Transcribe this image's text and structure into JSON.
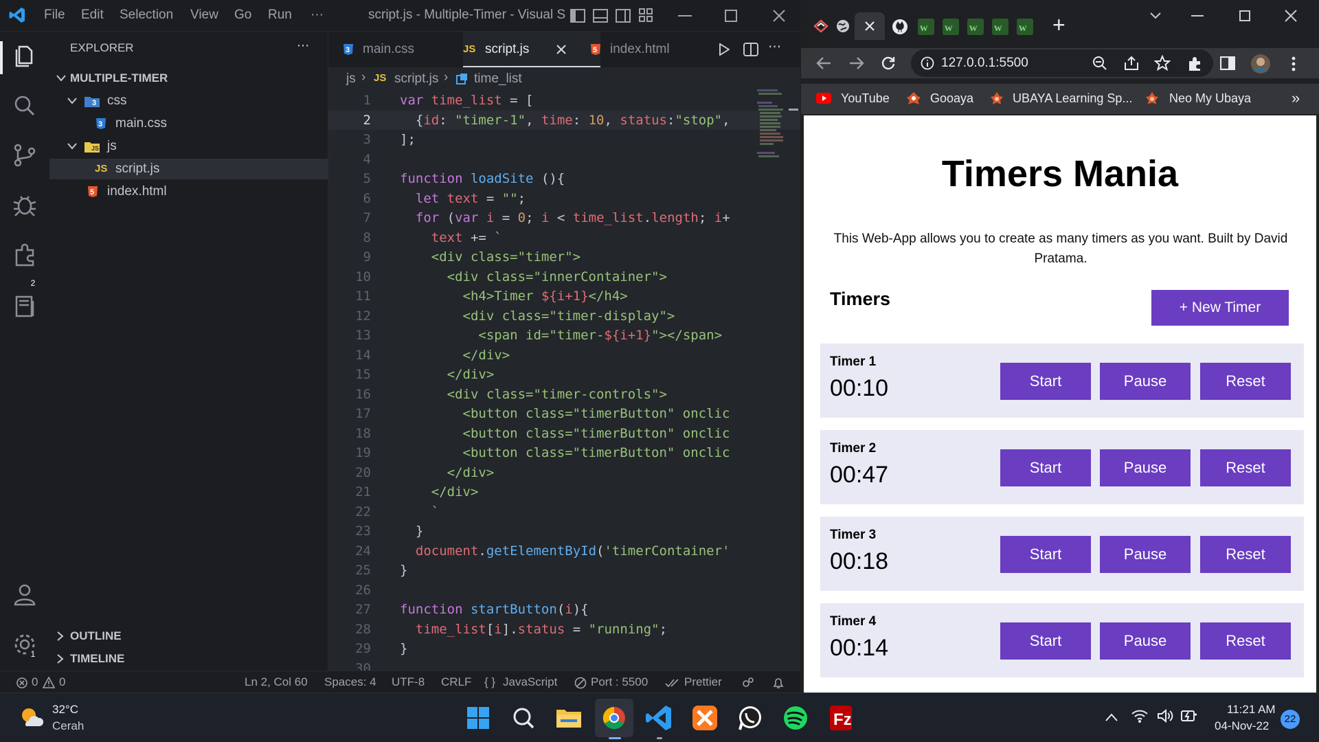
{
  "vscode": {
    "menu": [
      "File",
      "Edit",
      "Selection",
      "View",
      "Go",
      "Run",
      "···"
    ],
    "window_title": "script.js - Multiple-Timer - Visual S...",
    "explorer": {
      "title": "EXPLORER",
      "more": "···",
      "project": "MULTIPLE-TIMER",
      "items": [
        {
          "label": "css",
          "type": "folder"
        },
        {
          "label": "main.css",
          "type": "css"
        },
        {
          "label": "js",
          "type": "folder"
        },
        {
          "label": "script.js",
          "type": "js"
        },
        {
          "label": "index.html",
          "type": "html"
        }
      ],
      "outline": "OUTLINE",
      "timeline": "TIMELINE"
    },
    "activity_badges": {
      "extensions": "2",
      "settings": "1"
    },
    "tabs": [
      {
        "label": "main.css",
        "icon_text": "3"
      },
      {
        "label": "script.js",
        "icon_text": "JS",
        "active": true
      },
      {
        "label": "index.html",
        "icon_text": "5"
      }
    ],
    "breadcrumb": {
      "folder": "js",
      "file_icon": "JS",
      "file": "script.js",
      "symbol": "time_list"
    },
    "code_lines": [
      {
        "n": "1",
        "html": "<span class='kw'>var</span> <span class='var'>time_list</span> = ["
      },
      {
        "n": "2",
        "html": "  {<span class='var'>id</span>: <span class='str'>\"timer-1\"</span>, <span class='var'>time</span>: <span class='num'>10</span>, <span class='var'>status</span>:<span class='str'>\"stop\"</span>,"
      },
      {
        "n": "3",
        "html": "];"
      },
      {
        "n": "4",
        "html": ""
      },
      {
        "n": "5",
        "html": "<span class='kw'>function</span> <span class='fn'>loadSite</span> (){"
      },
      {
        "n": "6",
        "html": "  <span class='kw'>let</span> <span class='var'>text</span> = <span class='str'>\"\"</span>;"
      },
      {
        "n": "7",
        "html": "  <span class='kw'>for</span> (<span class='kw'>var</span> <span class='var'>i</span> = <span class='num'>0</span>; <span class='var'>i</span> &lt; <span class='var'>time_list</span>.<span class='var'>length</span>; <span class='var'>i</span>+"
      },
      {
        "n": "8",
        "html": "    <span class='var'>text</span> += <span class='str'>`</span>"
      },
      {
        "n": "9",
        "html": "<span class='str'>    &lt;div class=\"timer\"&gt;</span>"
      },
      {
        "n": "10",
        "html": "<span class='str'>      &lt;div class=\"innerContainer\"&gt;</span>"
      },
      {
        "n": "11",
        "html": "<span class='str'>        &lt;h4&gt;Timer </span><span class='var'>${i+1}</span><span class='str'>&lt;/h4&gt;</span>"
      },
      {
        "n": "12",
        "html": "<span class='str'>        &lt;div class=\"timer-display\"&gt;</span>"
      },
      {
        "n": "13",
        "html": "<span class='str'>          &lt;span id=\"timer-</span><span class='var'>${i+1}</span><span class='str'>\"&gt;&lt;/span&gt;</span>"
      },
      {
        "n": "14",
        "html": "<span class='str'>        &lt;/div&gt;</span>"
      },
      {
        "n": "15",
        "html": "<span class='str'>      &lt;/div&gt;</span>"
      },
      {
        "n": "16",
        "html": "<span class='str'>      &lt;div class=\"timer-controls\"&gt;</span>"
      },
      {
        "n": "17",
        "html": "<span class='str'>        &lt;button class=\"timerButton\" onclic</span>"
      },
      {
        "n": "18",
        "html": "<span class='str'>        &lt;button class=\"timerButton\" onclic</span>"
      },
      {
        "n": "19",
        "html": "<span class='str'>        &lt;button class=\"timerButton\" onclic</span>"
      },
      {
        "n": "20",
        "html": "<span class='str'>      &lt;/div&gt;</span>"
      },
      {
        "n": "21",
        "html": "<span class='str'>    &lt;/div&gt;</span>"
      },
      {
        "n": "22",
        "html": "<span class='str'>    `</span>"
      },
      {
        "n": "23",
        "html": "  }"
      },
      {
        "n": "24",
        "html": "  <span class='var'>document</span>.<span class='fn'>getElementById</span>(<span class='str'>'timerContainer'</span>"
      },
      {
        "n": "25",
        "html": "}"
      },
      {
        "n": "26",
        "html": ""
      },
      {
        "n": "27",
        "html": "<span class='kw'>function</span> <span class='fn'>startButton</span>(<span class='var'>i</span>){"
      },
      {
        "n": "28",
        "html": "  <span class='var'>time_list</span>[<span class='var'>i</span>].<span class='var'>status</span> = <span class='str'>\"running\"</span>;"
      },
      {
        "n": "29",
        "html": "}"
      },
      {
        "n": "30",
        "html": ""
      }
    ],
    "status": {
      "errors": "0",
      "warnings": "0",
      "position": "Ln 2, Col 60",
      "spaces": "Spaces: 4",
      "encoding": "UTF-8",
      "eol": "CRLF",
      "language": "JavaScript",
      "port": "Port : 5500",
      "prettier": "Prettier"
    }
  },
  "browser": {
    "new_tab": "+",
    "address": "127.0.0.1:5500",
    "bookmarks": [
      "YouTube",
      "Gooaya",
      "UBAYA Learning Sp...",
      "Neo My Ubaya"
    ],
    "bookmark_overflow": "»",
    "page": {
      "title": "Timers Mania",
      "description": "This Web-App allows you to create as many timers as you want. Built by David Pratama.",
      "section": "Timers",
      "new_timer": "+ New Timer",
      "timers": [
        {
          "name": "Timer 1",
          "time": "00:10"
        },
        {
          "name": "Timer 2",
          "time": "00:47"
        },
        {
          "name": "Timer 3",
          "time": "00:18"
        },
        {
          "name": "Timer 4",
          "time": "00:14"
        }
      ],
      "buttons": {
        "start": "Start",
        "pause": "Pause",
        "reset": "Reset"
      }
    }
  },
  "taskbar": {
    "weather": {
      "temp": "32°C",
      "desc": "Cerah"
    },
    "time": "11:21 AM",
    "date": "04-Nov-22",
    "notif": "22"
  },
  "colors": {
    "accent_purple": "#6a3dc1",
    "card_bg": "#e8e9f4",
    "vscode_bg": "#23262b"
  }
}
